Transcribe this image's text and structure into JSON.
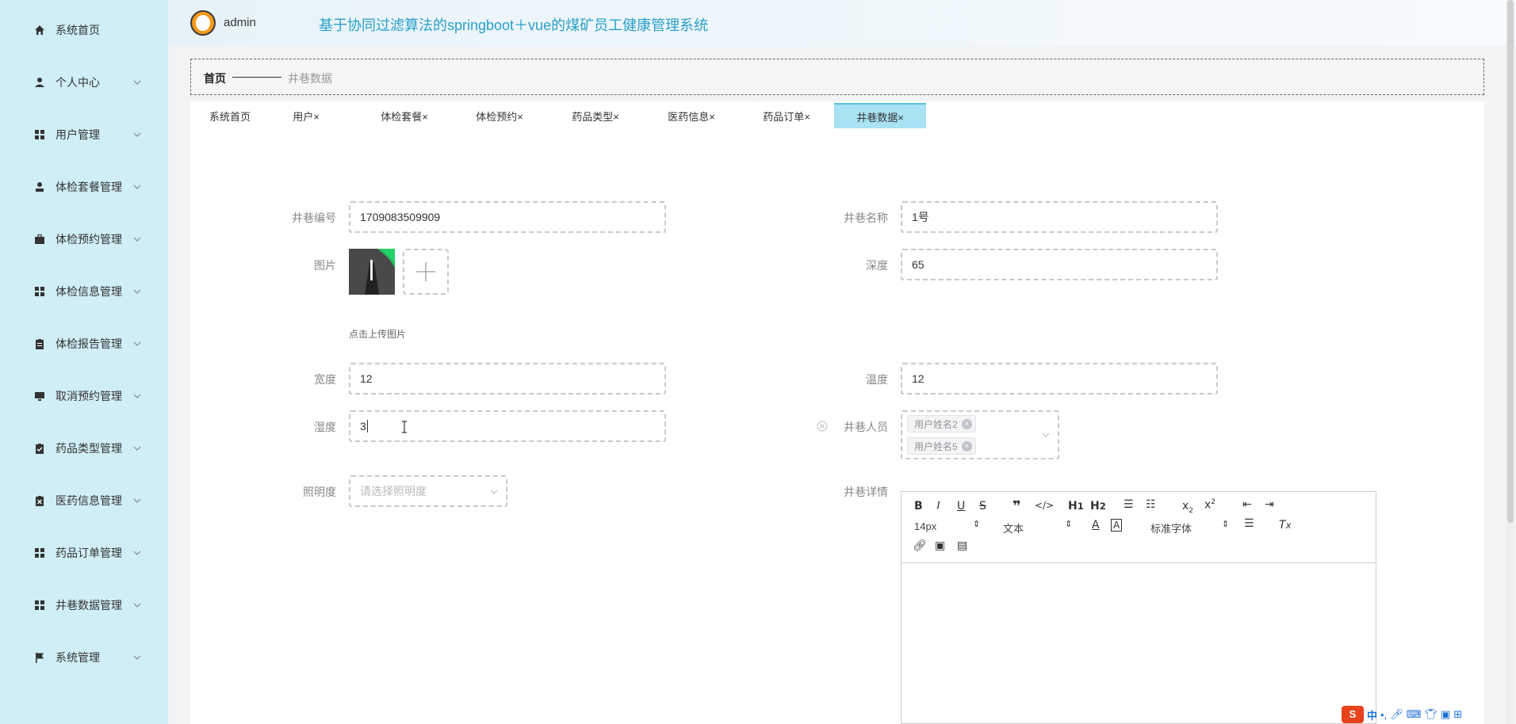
{
  "sidebar": {
    "items": [
      {
        "label": "系统首页",
        "icon": "home-icon"
      },
      {
        "label": "个人中心",
        "icon": "user-icon"
      },
      {
        "label": "用户管理",
        "icon": "grid-icon"
      },
      {
        "label": "体检套餐管理",
        "icon": "person-icon"
      },
      {
        "label": "体检预约管理",
        "icon": "briefcase-icon"
      },
      {
        "label": "体检信息管理",
        "icon": "grid-icon"
      },
      {
        "label": "体检报告管理",
        "icon": "clipboard-icon"
      },
      {
        "label": "取消预约管理",
        "icon": "monitor-icon"
      },
      {
        "label": "药品类型管理",
        "icon": "check-clipboard-icon"
      },
      {
        "label": "医药信息管理",
        "icon": "x-clipboard-icon"
      },
      {
        "label": "药品订单管理",
        "icon": "grid-icon"
      },
      {
        "label": "井巷数据管理",
        "icon": "grid-icon"
      },
      {
        "label": "系统管理",
        "icon": "flag-icon"
      }
    ]
  },
  "header": {
    "username": "admin",
    "title": "基于协同过滤算法的springboot＋vue的煤矿员工健康管理系统"
  },
  "breadcrumb": {
    "home": "首页",
    "current": "井巷数据"
  },
  "tabs": [
    {
      "label": "系统首页"
    },
    {
      "label": "用户×"
    },
    {
      "label": "体检套餐×"
    },
    {
      "label": "体检预约×"
    },
    {
      "label": "药品类型×"
    },
    {
      "label": "医药信息×"
    },
    {
      "label": "药品订单×"
    },
    {
      "label": "井巷数据×"
    }
  ],
  "form": {
    "shaft_no": {
      "label": "井巷编号",
      "value": "1709083509909"
    },
    "shaft_name": {
      "label": "井巷名称",
      "value": "1号"
    },
    "image": {
      "label": "图片",
      "hint": "点击上传图片"
    },
    "depth": {
      "label": "深度",
      "value": "65"
    },
    "width": {
      "label": "宽度",
      "value": "12"
    },
    "temperature": {
      "label": "温度",
      "value": "12"
    },
    "humidity": {
      "label": "湿度",
      "value": "3"
    },
    "personnel": {
      "label": "井巷人员",
      "tags": [
        "用户姓名2",
        "用户姓名5"
      ]
    },
    "illuminance": {
      "label": "照明度",
      "placeholder": "请选择照明度"
    },
    "details": {
      "label": "井巷详情"
    }
  },
  "editor": {
    "font_size": "14px",
    "text_type": "文本",
    "font_family": "标准字体"
  },
  "ime": {
    "label": "中"
  }
}
